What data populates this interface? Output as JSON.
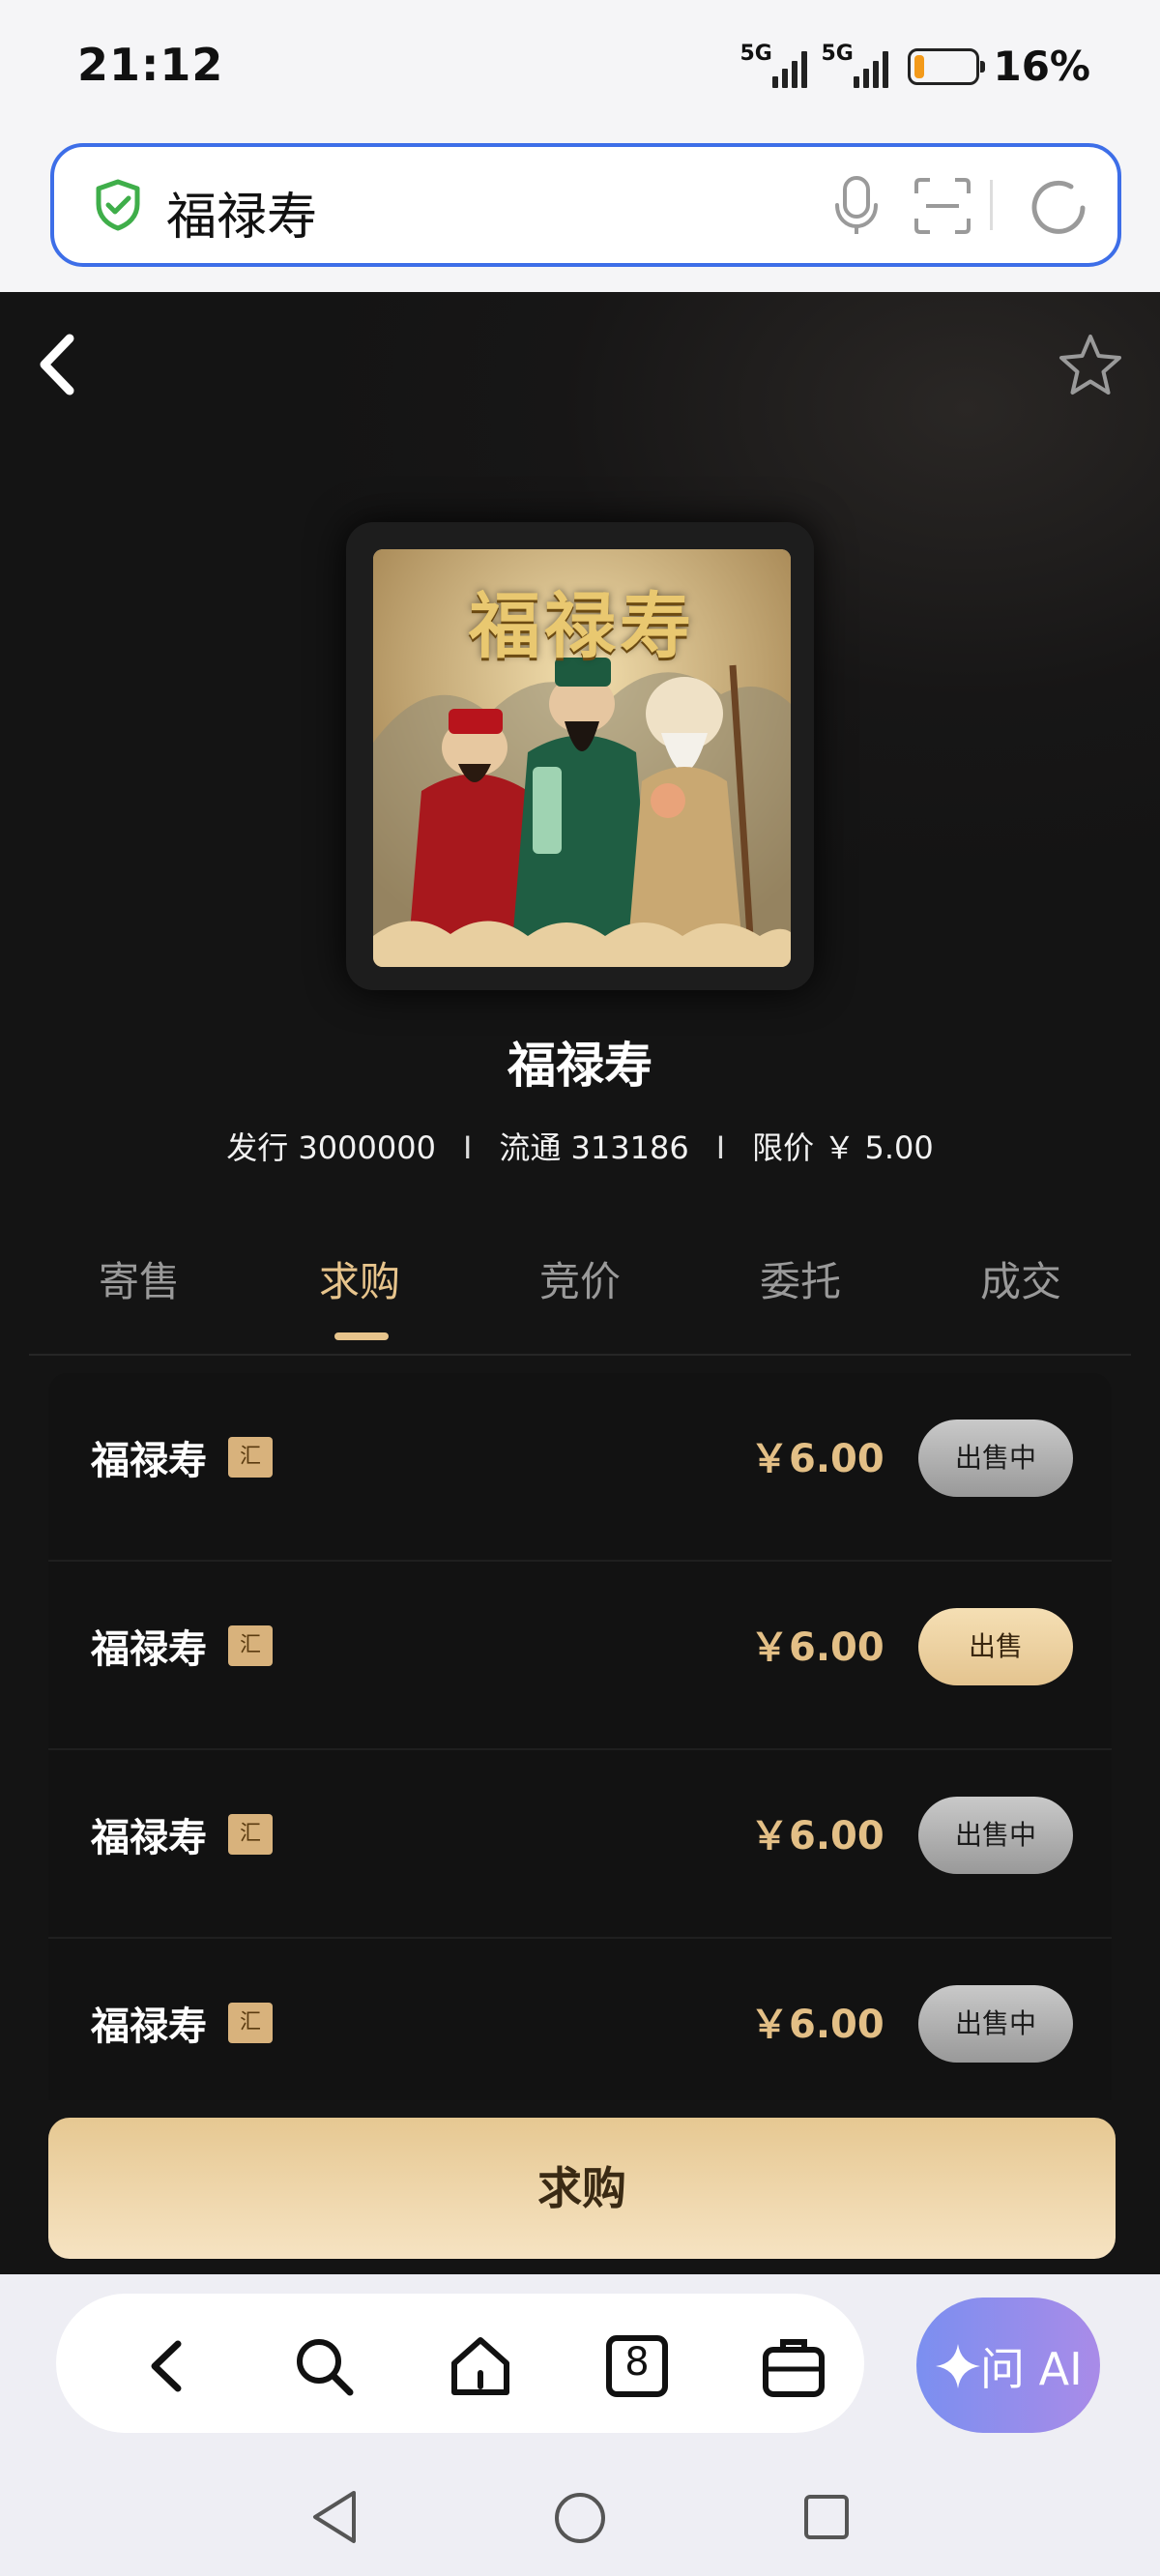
{
  "status_bar": {
    "time": "21:12",
    "network1": "5G",
    "network2": "5G",
    "battery": "16%",
    "battery_level": 0.16
  },
  "url_bar": {
    "query": "福禄寿"
  },
  "item": {
    "cover_title": "福禄寿",
    "title": "福禄寿",
    "issue": "发行 3000000",
    "circulation": "流通 313186",
    "price_limit": "限价 ￥ 5.00",
    "separator": "I"
  },
  "tabs": [
    {
      "label": "寄售",
      "active": false
    },
    {
      "label": "求购",
      "active": true
    },
    {
      "label": "竞价",
      "active": false
    },
    {
      "label": "委托",
      "active": false
    },
    {
      "label": "成交",
      "active": false
    }
  ],
  "listings": [
    {
      "name": "福禄寿",
      "tag": "汇",
      "price": "￥6.00",
      "action": "出售中",
      "style": "gray"
    },
    {
      "name": "福禄寿",
      "tag": "汇",
      "price": "￥6.00",
      "action": "出售",
      "style": "gold"
    },
    {
      "name": "福禄寿",
      "tag": "汇",
      "price": "￥6.00",
      "action": "出售中",
      "style": "gray"
    },
    {
      "name": "福禄寿",
      "tag": "汇",
      "price": "￥6.00",
      "action": "出售中",
      "style": "gray"
    }
  ],
  "buy_button": "求购",
  "toolbar": {
    "tabs_count": "8",
    "ai_label": "问 AI"
  },
  "colors": {
    "accent_gold": "#e7c48c",
    "url_border": "#3d6ee8",
    "page_bg": "#141414"
  }
}
